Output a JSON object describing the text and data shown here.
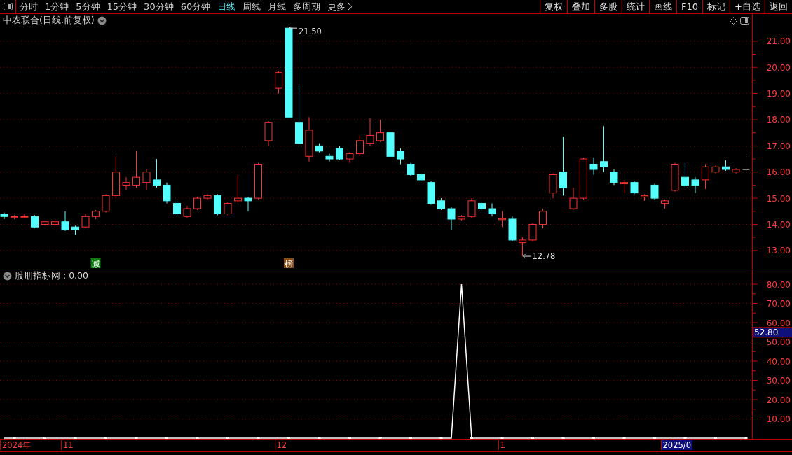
{
  "toolbar": {
    "periods": [
      {
        "label": "分时",
        "selected": false
      },
      {
        "label": "1分钟",
        "selected": false
      },
      {
        "label": "5分钟",
        "selected": false
      },
      {
        "label": "15分钟",
        "selected": false
      },
      {
        "label": "30分钟",
        "selected": false
      },
      {
        "label": "60分钟",
        "selected": false
      },
      {
        "label": "日线",
        "selected": true
      },
      {
        "label": "周线",
        "selected": false
      },
      {
        "label": "月线",
        "selected": false
      },
      {
        "label": "多周期",
        "selected": false
      }
    ],
    "more": "更多",
    "actions": [
      "复权",
      "叠加",
      "多股",
      "统计",
      "画线",
      "F10",
      "标记",
      "+自选",
      "返回"
    ]
  },
  "main_panel": {
    "title": "中农联合(日线.前复权)",
    "chart_data": {
      "type": "candlestick",
      "ylim": [
        12.3,
        22.04
      ],
      "grid": true,
      "yticks": [
        {
          "value": 13,
          "label": "13.00"
        },
        {
          "value": 14,
          "label": "14.00"
        },
        {
          "value": 15,
          "label": "15.00"
        },
        {
          "value": 16,
          "label": "16.00"
        },
        {
          "value": 17,
          "label": "17.00"
        },
        {
          "value": 18,
          "label": "18.00"
        },
        {
          "value": 19,
          "label": "19.00"
        },
        {
          "value": 20,
          "label": "20.00"
        },
        {
          "value": 21,
          "label": "21.00"
        }
      ],
      "ohlc": [
        [
          14.4,
          14.45,
          14.2,
          14.3
        ],
        [
          14.28,
          14.35,
          14.2,
          14.3
        ],
        [
          14.28,
          14.4,
          14.25,
          14.3
        ],
        [
          14.3,
          14.35,
          13.85,
          13.9
        ],
        [
          14.0,
          14.1,
          13.95,
          14.1
        ],
        [
          14.0,
          14.15,
          13.95,
          14.1
        ],
        [
          14.1,
          14.5,
          13.75,
          13.8
        ],
        [
          13.9,
          13.95,
          13.6,
          13.8
        ],
        [
          13.9,
          14.4,
          13.85,
          14.3
        ],
        [
          14.3,
          14.55,
          14.2,
          14.5
        ],
        [
          14.5,
          15.15,
          14.45,
          15.1
        ],
        [
          15.1,
          16.6,
          15.0,
          16.0
        ],
        [
          15.5,
          15.8,
          15.3,
          15.6
        ],
        [
          15.5,
          16.8,
          15.4,
          15.8
        ],
        [
          15.6,
          16.1,
          15.3,
          16.0
        ],
        [
          15.7,
          16.5,
          15.4,
          15.5
        ],
        [
          15.5,
          15.6,
          14.8,
          14.9
        ],
        [
          14.8,
          14.9,
          14.3,
          14.4
        ],
        [
          14.3,
          14.7,
          14.25,
          14.6
        ],
        [
          14.6,
          15.05,
          14.55,
          15.0
        ],
        [
          15.0,
          15.15,
          14.95,
          15.1
        ],
        [
          15.1,
          15.15,
          14.35,
          14.4
        ],
        [
          14.4,
          14.85,
          14.35,
          14.8
        ],
        [
          14.9,
          15.9,
          14.85,
          15.0
        ],
        [
          15.0,
          15.05,
          14.5,
          14.9
        ],
        [
          15.0,
          16.35,
          14.95,
          16.3
        ],
        [
          17.2,
          17.95,
          17.0,
          17.9
        ],
        [
          19.2,
          19.85,
          19.0,
          19.8
        ],
        [
          21.5,
          21.5,
          18.1,
          18.1
        ],
        [
          17.9,
          19.3,
          17.05,
          17.1
        ],
        [
          16.6,
          18.1,
          16.4,
          17.6
        ],
        [
          17.0,
          17.1,
          16.75,
          16.8
        ],
        [
          16.6,
          16.7,
          16.4,
          16.5
        ],
        [
          16.9,
          17.0,
          16.45,
          16.5
        ],
        [
          16.5,
          16.75,
          16.35,
          16.7
        ],
        [
          16.7,
          17.4,
          16.6,
          17.2
        ],
        [
          17.1,
          18.05,
          17.0,
          17.4
        ],
        [
          17.2,
          18.0,
          17.15,
          17.5
        ],
        [
          17.5,
          17.5,
          16.6,
          16.6
        ],
        [
          16.8,
          16.9,
          16.3,
          16.5
        ],
        [
          16.3,
          16.35,
          15.85,
          15.9
        ],
        [
          15.9,
          15.95,
          15.65,
          15.7
        ],
        [
          15.6,
          15.65,
          14.75,
          14.8
        ],
        [
          14.9,
          15.0,
          14.55,
          14.6
        ],
        [
          14.6,
          14.65,
          13.8,
          14.2
        ],
        [
          14.2,
          14.35,
          14.15,
          14.3
        ],
        [
          14.3,
          15.0,
          14.25,
          14.9
        ],
        [
          14.8,
          14.85,
          14.5,
          14.6
        ],
        [
          14.6,
          14.8,
          14.3,
          14.4
        ],
        [
          14.18,
          14.5,
          13.9,
          14.22
        ],
        [
          14.2,
          14.3,
          13.35,
          13.4
        ],
        [
          13.3,
          13.5,
          12.78,
          13.4
        ],
        [
          13.4,
          14.05,
          13.35,
          14.0
        ],
        [
          14.0,
          14.6,
          13.85,
          14.5
        ],
        [
          15.2,
          15.95,
          15.0,
          15.9
        ],
        [
          16.0,
          17.35,
          15.1,
          15.4
        ],
        [
          14.6,
          15.4,
          14.55,
          15.0
        ],
        [
          15.0,
          16.55,
          14.95,
          16.5
        ],
        [
          16.3,
          16.55,
          15.9,
          16.1
        ],
        [
          16.4,
          17.75,
          16.0,
          16.2
        ],
        [
          16.0,
          16.1,
          15.5,
          15.6
        ],
        [
          15.55,
          15.7,
          15.2,
          15.6
        ],
        [
          15.6,
          15.65,
          15.15,
          15.2
        ],
        [
          15.05,
          15.15,
          14.9,
          15.1
        ],
        [
          15.5,
          15.55,
          14.95,
          15.0
        ],
        [
          14.8,
          14.95,
          14.6,
          14.9
        ],
        [
          15.3,
          16.35,
          15.25,
          16.3
        ],
        [
          15.8,
          16.35,
          15.4,
          15.5
        ],
        [
          15.7,
          15.8,
          15.2,
          15.5
        ],
        [
          15.7,
          16.3,
          15.35,
          16.2
        ],
        [
          16.0,
          16.25,
          15.95,
          16.2
        ],
        [
          16.2,
          16.45,
          16.05,
          16.1
        ],
        [
          16.0,
          16.15,
          15.95,
          16.1
        ],
        [
          16.1,
          16.6,
          15.95,
          16.1
        ]
      ]
    },
    "extremes": {
      "high": "21.50",
      "low": "12.78"
    },
    "signals": [
      {
        "label": "减",
        "color": "#0a7d0a"
      },
      {
        "label": "榜",
        "color": "#8a4a12"
      }
    ]
  },
  "indicator_panel": {
    "reading": ": 0.00",
    "value_marker": "52.80",
    "chart_data": {
      "type": "line",
      "ylim": [
        -0.36,
        87.64
      ],
      "grid": true,
      "yticks": [
        {
          "value": 10,
          "label": "10.00"
        },
        {
          "value": 20,
          "label": "20.00"
        },
        {
          "value": 30,
          "label": "30.00"
        },
        {
          "value": 40,
          "label": "40.00"
        },
        {
          "value": 50,
          "label": "50.00"
        },
        {
          "value": 60,
          "label": "60.00"
        },
        {
          "value": 70,
          "label": "70.00"
        },
        {
          "value": 80,
          "label": "80.00"
        }
      ],
      "series": [
        {
          "name": "股朋指标网",
          "color": "#ffffff",
          "values": [
            0,
            0,
            0,
            0,
            0,
            0,
            0,
            0,
            0,
            0,
            0,
            0,
            0,
            0,
            0,
            0,
            0,
            0,
            0,
            0,
            0,
            0,
            0,
            0,
            0,
            0,
            0,
            0,
            0,
            0,
            0,
            0,
            0,
            0,
            0,
            0,
            0,
            0,
            0,
            0,
            0,
            0,
            0,
            0,
            0,
            80,
            0,
            0,
            0,
            0,
            0,
            0,
            0,
            0,
            0,
            0,
            0,
            0,
            0,
            0,
            0,
            0,
            0,
            0,
            0,
            0,
            0,
            0,
            0,
            0,
            0,
            0,
            0,
            0
          ]
        }
      ]
    }
  },
  "date_axis": [
    {
      "label": "2024年",
      "kind": "date"
    },
    {
      "label": "11",
      "kind": "date"
    },
    {
      "label": "12",
      "kind": "date"
    },
    {
      "label": "1",
      "kind": "date"
    },
    {
      "label": "2025/0",
      "kind": "cursor"
    }
  ]
}
